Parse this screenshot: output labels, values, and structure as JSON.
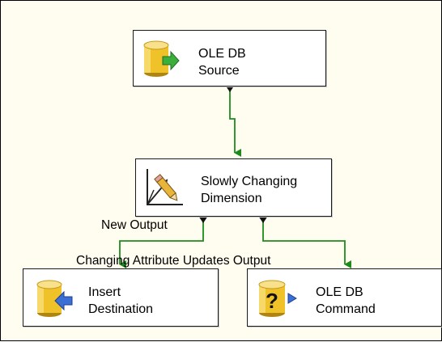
{
  "components": {
    "source": {
      "line1": "OLE DB",
      "line2": "Source",
      "icon": "database-output-icon"
    },
    "scd": {
      "line1": "Slowly Changing",
      "line2": "Dimension",
      "icon": "slowly-changing-dimension-icon"
    },
    "insert": {
      "line1": "Insert",
      "line2": "Destination",
      "icon": "database-input-icon"
    },
    "command": {
      "line1": "OLE DB",
      "line2": "Command",
      "icon": "database-query-icon"
    }
  },
  "paths": {
    "new_output": "New Output",
    "changing_output": "Changing Attribute Updates Output"
  },
  "colors": {
    "background": "#fffdf0",
    "flow_line": "#1e8a1e",
    "cylinder": "#f0c22a",
    "arrow_green": "#3cae3c",
    "arrow_blue": "#3a6fd6"
  }
}
